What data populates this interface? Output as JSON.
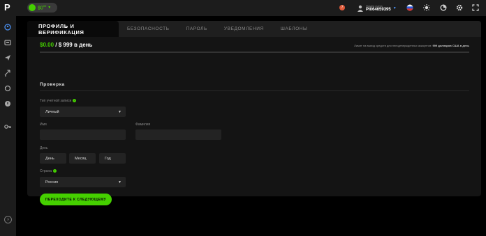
{
  "app": {
    "logo": "P"
  },
  "topbar": {
    "balance_main": "$0",
    "balance_cents": "00",
    "notification_count": "7",
    "account_label": "Номер счета",
    "account_number": "PI064659395"
  },
  "tabs": [
    {
      "label": "Профиль и верификация",
      "active": true
    },
    {
      "label": "Безопасность"
    },
    {
      "label": "Пароль"
    },
    {
      "label": "Уведомления"
    },
    {
      "label": "Шаблоны"
    }
  ],
  "limit": {
    "current": "$0.00",
    "separator": "/",
    "max": "$ 999 в день",
    "note_prefix": "Лимит на вывод средств для неподтвержденных аккаунтов:",
    "note_value": "999 долларов США в день",
    "progress_fraction": 0.0
  },
  "section": {
    "title": "Проверка"
  },
  "form": {
    "account_type_label": "Тип учетной записи",
    "account_type_value": "Личный",
    "first_name_label": "Имя",
    "last_name_label": "Фамилия",
    "dob_label": "День",
    "day_placeholder": "День",
    "month_placeholder": "Месяц",
    "year_placeholder": "Год",
    "country_label": "Страна",
    "country_value": "Россия",
    "submit_label": "Переходите к следующему"
  },
  "colors": {
    "accent": "#45d000",
    "background": "#000000",
    "panel": "#141414"
  }
}
